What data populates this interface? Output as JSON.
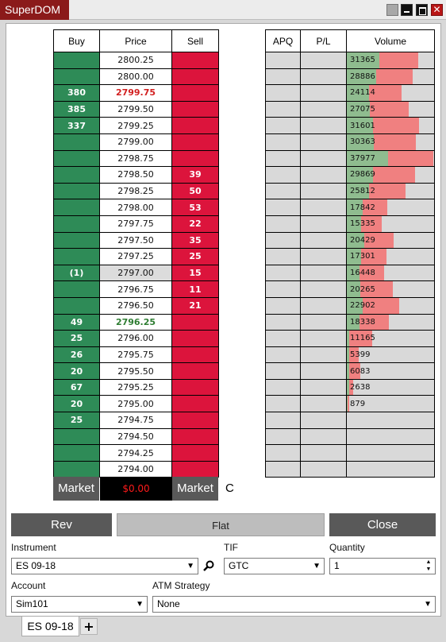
{
  "window": {
    "title": "SuperDOM",
    "controls": [
      "restore-icon",
      "minimize-icon",
      "maximize-icon",
      "close-icon"
    ]
  },
  "ladder": {
    "headers": {
      "buy": "Buy",
      "price": "Price",
      "sell": "Sell"
    },
    "rows": [
      {
        "buy": "",
        "price": "2800.25",
        "sell": ""
      },
      {
        "buy": "",
        "price": "2800.00",
        "sell": ""
      },
      {
        "buy": "380",
        "price": "2799.75",
        "sell": "",
        "highlight": "ask"
      },
      {
        "buy": "385",
        "price": "2799.50",
        "sell": ""
      },
      {
        "buy": "337",
        "price": "2799.25",
        "sell": ""
      },
      {
        "buy": "",
        "price": "2799.00",
        "sell": ""
      },
      {
        "buy": "",
        "price": "2798.75",
        "sell": ""
      },
      {
        "buy": "",
        "price": "2798.50",
        "sell": "39"
      },
      {
        "buy": "",
        "price": "2798.25",
        "sell": "50"
      },
      {
        "buy": "",
        "price": "2798.00",
        "sell": "53"
      },
      {
        "buy": "",
        "price": "2797.75",
        "sell": "22"
      },
      {
        "buy": "",
        "price": "2797.50",
        "sell": "35"
      },
      {
        "buy": "",
        "price": "2797.25",
        "sell": "25"
      },
      {
        "buy": "(1)",
        "price": "2797.00",
        "sell": "15",
        "highlight": "last"
      },
      {
        "buy": "",
        "price": "2796.75",
        "sell": "11"
      },
      {
        "buy": "",
        "price": "2796.50",
        "sell": "21"
      },
      {
        "buy": "49",
        "price": "2796.25",
        "sell": "",
        "highlight": "bid"
      },
      {
        "buy": "25",
        "price": "2796.00",
        "sell": ""
      },
      {
        "buy": "26",
        "price": "2795.75",
        "sell": ""
      },
      {
        "buy": "20",
        "price": "2795.50",
        "sell": ""
      },
      {
        "buy": "67",
        "price": "2795.25",
        "sell": ""
      },
      {
        "buy": "20",
        "price": "2795.00",
        "sell": ""
      },
      {
        "buy": "25",
        "price": "2794.75",
        "sell": ""
      },
      {
        "buy": "",
        "price": "2794.50",
        "sell": ""
      },
      {
        "buy": "",
        "price": "2794.25",
        "sell": ""
      },
      {
        "buy": "",
        "price": "2794.00",
        "sell": ""
      }
    ],
    "buy_market_label": "Market",
    "sell_market_label": "Market",
    "pnl": "$0.00",
    "c_label": "C"
  },
  "columns": {
    "headers": {
      "apq": "APQ",
      "pl": "P/L",
      "volume": "Volume"
    },
    "volume_max": 37977,
    "volumes": [
      {
        "value": "31365",
        "total": 31365,
        "buy_fraction": 0.46
      },
      {
        "value": "28886",
        "total": 28886,
        "buy_fraction": 0.44
      },
      {
        "value": "24114",
        "total": 24114,
        "buy_fraction": 0.41
      },
      {
        "value": "27075",
        "total": 27075,
        "buy_fraction": 0.37
      },
      {
        "value": "31601",
        "total": 31601,
        "buy_fraction": 0.36
      },
      {
        "value": "30363",
        "total": 30363,
        "buy_fraction": 0.39
      },
      {
        "value": "37977",
        "total": 37977,
        "buy_fraction": 0.48
      },
      {
        "value": "29869",
        "total": 29869,
        "buy_fraction": 0.38
      },
      {
        "value": "25812",
        "total": 25812,
        "buy_fraction": 0.38
      },
      {
        "value": "17842",
        "total": 17842,
        "buy_fraction": 0.39
      },
      {
        "value": "15335",
        "total": 15335,
        "buy_fraction": 0.4
      },
      {
        "value": "20429",
        "total": 20429,
        "buy_fraction": 0.37
      },
      {
        "value": "17301",
        "total": 17301,
        "buy_fraction": 0.35
      },
      {
        "value": "16448",
        "total": 16448,
        "buy_fraction": 0.35
      },
      {
        "value": "20265",
        "total": 20265,
        "buy_fraction": 0.3
      },
      {
        "value": "22902",
        "total": 22902,
        "buy_fraction": 0.3
      },
      {
        "value": "18338",
        "total": 18338,
        "buy_fraction": 0.3
      },
      {
        "value": "11165",
        "total": 11165,
        "buy_fraction": 0.1
      },
      {
        "value": "5399",
        "total": 5399,
        "buy_fraction": 0.2
      },
      {
        "value": "6083",
        "total": 6083,
        "buy_fraction": 0.2
      },
      {
        "value": "2638",
        "total": 2638,
        "buy_fraction": 0.4
      },
      {
        "value": "879",
        "total": 879,
        "buy_fraction": 0.2
      },
      {
        "value": "",
        "total": 0,
        "buy_fraction": 0
      },
      {
        "value": "",
        "total": 0,
        "buy_fraction": 0
      },
      {
        "value": "",
        "total": 0,
        "buy_fraction": 0
      },
      {
        "value": "",
        "total": 0,
        "buy_fraction": 0
      }
    ]
  },
  "actions": {
    "rev": "Rev",
    "flat": "Flat",
    "close": "Close"
  },
  "order_entry": {
    "instrument_label": "Instrument",
    "instrument_value": "ES 09-18",
    "tif_label": "TIF",
    "tif_value": "GTC",
    "quantity_label": "Quantity",
    "quantity_value": "1",
    "account_label": "Account",
    "account_value": "Sim101",
    "atm_label": "ATM Strategy",
    "atm_value": "None"
  },
  "tabs": {
    "active": "ES 09-18",
    "add": "+"
  },
  "colors": {
    "title_bg": "#8b1a1a",
    "buy_green": "#2e8b57",
    "sell_red": "#dc143c",
    "volume_red": "#f08080",
    "volume_green": "#8fbc8f"
  }
}
